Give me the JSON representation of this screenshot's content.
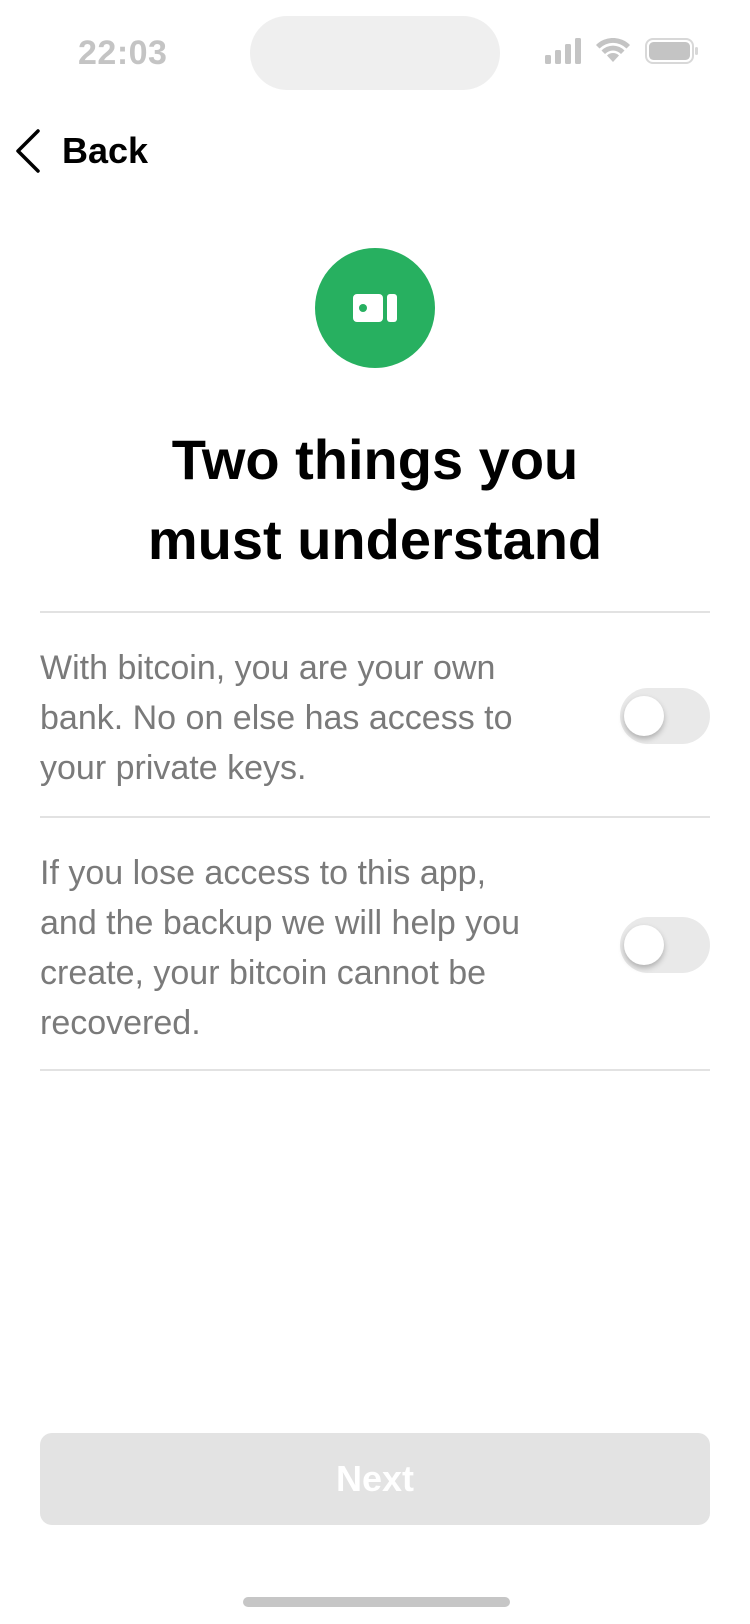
{
  "status_bar": {
    "time": "22:03",
    "icons": [
      "cellular-signal-icon",
      "wifi-icon",
      "battery-icon"
    ]
  },
  "nav": {
    "back_label": "Back",
    "back_icon": "chevron-left-icon"
  },
  "hero": {
    "icon": "wallet-card-icon",
    "background_color": "#27b060"
  },
  "title": {
    "line1": "Two things you",
    "line2": "must understand"
  },
  "items": [
    {
      "lines": [
        "With bitcoin, you are your own",
        "bank. No on else has access to",
        "your private keys."
      ],
      "toggle_on": false
    },
    {
      "lines": [
        "If you lose access to this app,",
        "and the backup we will help you",
        "create, your bitcoin cannot be",
        "recovered."
      ],
      "toggle_on": false
    }
  ],
  "next_button": {
    "label": "Next",
    "enabled": false
  },
  "colors": {
    "accent": "#27b060",
    "body_text": "#7a7a7a",
    "disabled_button": "#e3e3e3"
  }
}
